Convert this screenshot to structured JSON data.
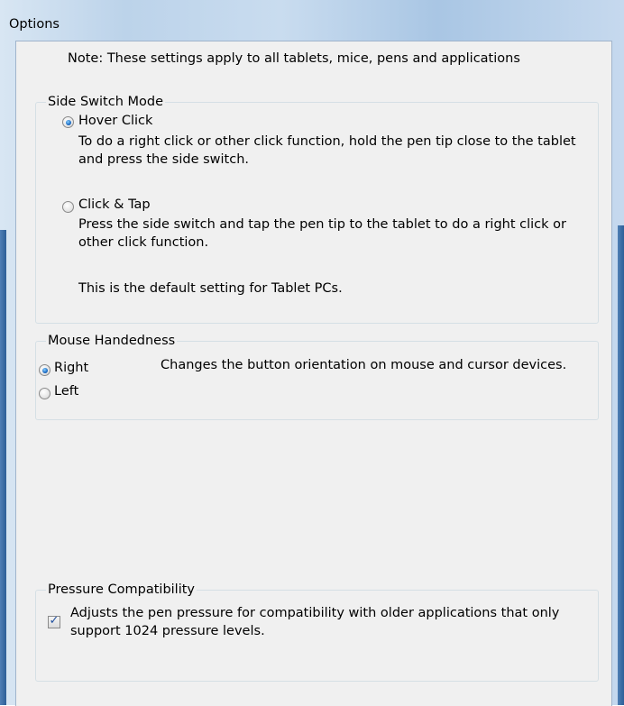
{
  "window": {
    "title": "Options"
  },
  "note": "Note: These settings apply to all tablets, mice, pens and applications",
  "side_switch": {
    "label": "Side Switch Mode",
    "options": [
      {
        "label": "Hover Click",
        "selected": true,
        "description": "To do a right click or other click function, hold the pen tip close to the tablet and press the side switch."
      },
      {
        "label": "Click & Tap",
        "selected": false,
        "description": "Press the side switch and tap the pen tip to the tablet to do a right click or other click function.",
        "extra": "This is the default setting for Tablet PCs."
      }
    ]
  },
  "mouse_handedness": {
    "label": "Mouse Handedness",
    "options": [
      {
        "label": "Right",
        "selected": true
      },
      {
        "label": "Left",
        "selected": false
      }
    ],
    "description": "Changes the button orientation on mouse and cursor devices."
  },
  "pressure": {
    "label": "Pressure Compatibility",
    "checked": true,
    "description": "Adjusts the pen pressure for compatibility with older applications that only support 1024 pressure levels."
  }
}
